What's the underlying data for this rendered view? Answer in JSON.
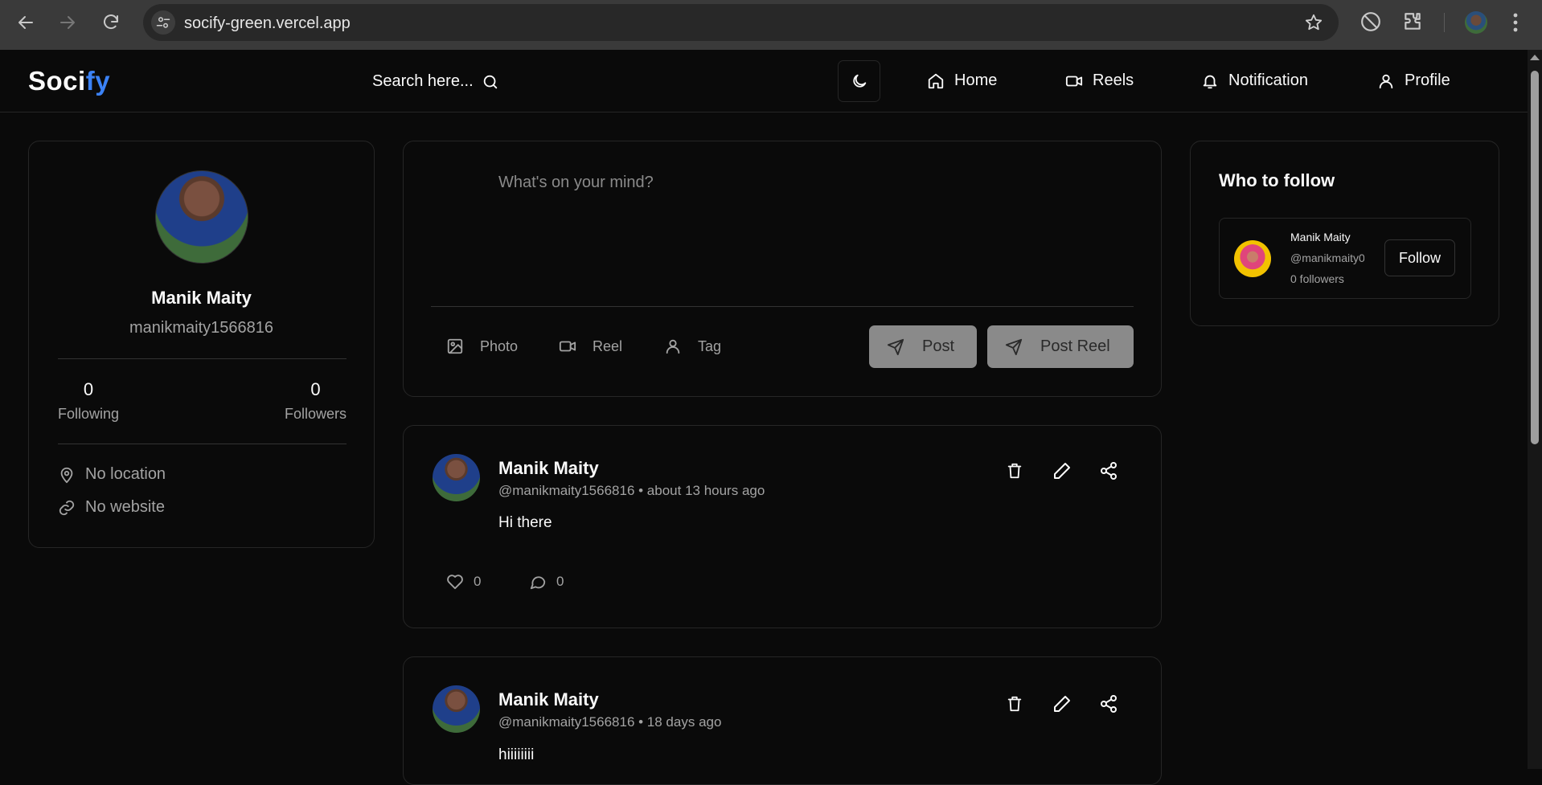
{
  "browser": {
    "url": "socify-green.vercel.app"
  },
  "app": {
    "logo_main": "Soci",
    "logo_accent": "fy",
    "accent_color": "#3b82f6",
    "search_label": "Search here...",
    "nav": [
      {
        "label": "Home",
        "icon": "home-icon"
      },
      {
        "label": "Reels",
        "icon": "video-icon"
      },
      {
        "label": "Notification",
        "icon": "bell-icon"
      },
      {
        "label": "Profile",
        "icon": "user-icon"
      }
    ]
  },
  "profile": {
    "name": "Manik Maity",
    "username": "manikmaity1566816",
    "following_count": "0",
    "following_label": "Following",
    "followers_count": "0",
    "followers_label": "Followers",
    "location": "No location",
    "website": "No website"
  },
  "composer": {
    "placeholder": "What's on your mind?",
    "photo_label": "Photo",
    "reel_label": "Reel",
    "tag_label": "Tag",
    "post_label": "Post",
    "post_reel_label": "Post Reel"
  },
  "posts": [
    {
      "name": "Manik Maity",
      "meta": "@manikmaity1566816 • about 13 hours ago",
      "body": "Hi there",
      "likes": "0",
      "comments": "0"
    },
    {
      "name": "Manik Maity",
      "meta": "@manikmaity1566816 • 18 days ago",
      "body": "hiiiiiiii"
    }
  ],
  "who_to_follow": {
    "title": "Who to follow",
    "name": "Manik Maity",
    "handle": "@manikmaity0",
    "followers": "0 followers",
    "follow_label": "Follow"
  }
}
